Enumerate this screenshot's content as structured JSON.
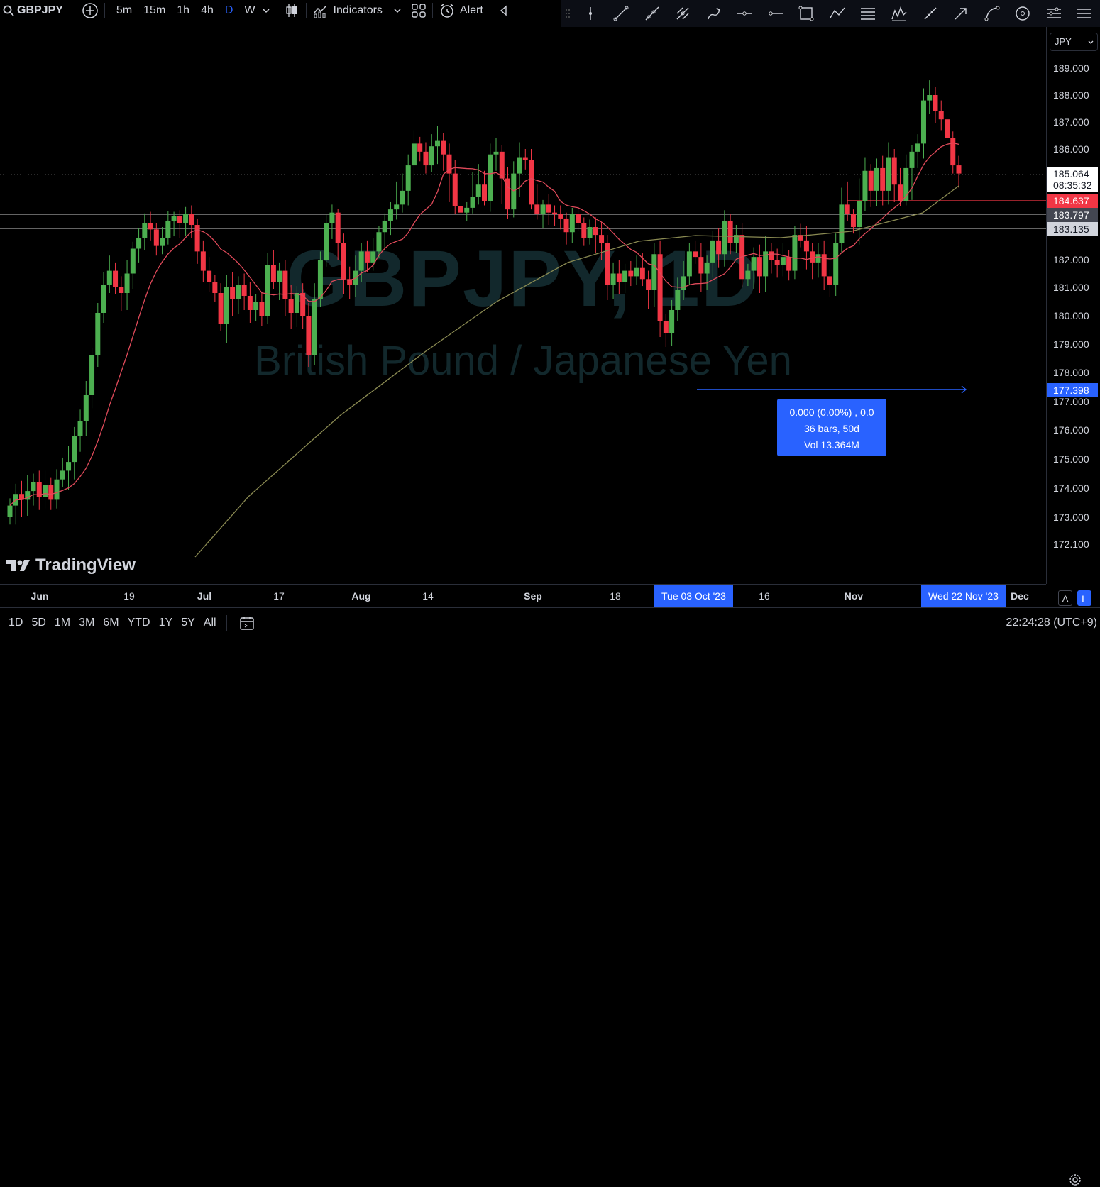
{
  "toolbar": {
    "symbol": "GBPJPY",
    "timeframes": [
      "5m",
      "15m",
      "1h",
      "4h",
      "D",
      "W"
    ],
    "active_timeframe": "D",
    "indicators_label": "Indicators",
    "alert_label": "Alert",
    "icons": [
      "search-icon",
      "add-symbol-icon",
      "chevron-down-icon",
      "candles-icon",
      "indicators-icon",
      "layout-grid-icon",
      "alert-clock-icon",
      "collapse-left-icon"
    ]
  },
  "drawing_tools": [
    "cursor-line-icon",
    "trend-line-icon",
    "ray-icon",
    "pitchfork-icon",
    "brush-icon",
    "horizontal-ray-icon",
    "horizontal-line-icon",
    "rectangle-icon",
    "path-icon",
    "fib-levels-icon",
    "pattern-icon",
    "measure-icon",
    "arrow-icon",
    "arc-icon",
    "circle-icon",
    "list-settings-icon",
    "more-icon"
  ],
  "watermark": {
    "symbol": "GBPJPY, 1D",
    "name": "British Pound / Japanese Yen"
  },
  "price_scale": {
    "currency": "JPY",
    "ticks": [
      "189.000",
      "188.000",
      "187.000",
      "186.000",
      "182.000",
      "181.000",
      "180.000",
      "179.000",
      "178.000",
      "177.000",
      "176.000",
      "175.000",
      "174.000",
      "173.000",
      "172.100"
    ],
    "current_price": "185.064",
    "countdown": "08:35:32",
    "tags": [
      {
        "value": "184.637",
        "bg": "#f23645",
        "color": "#ffffff"
      },
      {
        "value": "183.797",
        "bg": "#434651",
        "color": "#ffffff"
      },
      {
        "value": "183.135",
        "bg": "#d1d4dc",
        "color": "#131722"
      },
      {
        "value": "177.398",
        "bg": "#2962ff",
        "color": "#ffffff"
      }
    ]
  },
  "time_scale": {
    "labels": [
      {
        "text": "Jun",
        "bold": true
      },
      {
        "text": "19",
        "bold": false
      },
      {
        "text": "Jul",
        "bold": true
      },
      {
        "text": "17",
        "bold": false
      },
      {
        "text": "Aug",
        "bold": true
      },
      {
        "text": "14",
        "bold": false
      },
      {
        "text": "Sep",
        "bold": true
      },
      {
        "text": "18",
        "bold": false
      },
      {
        "text": "16",
        "bold": false
      },
      {
        "text": "Nov",
        "bold": true
      },
      {
        "text": "Dec",
        "bold": true
      }
    ],
    "highlight_start": "Tue 03 Oct '23",
    "highlight_end": "Wed 22 Nov '23"
  },
  "measure_box": {
    "line1": "0.000 (0.00%) , 0.0",
    "line2": "36 bars, 50d",
    "line3": "Vol 13.364M"
  },
  "logo": "TradingView",
  "scale_buttons": {
    "auto": "A",
    "log": "L"
  },
  "bottom_bar": {
    "ranges": [
      "1D",
      "5D",
      "1M",
      "3M",
      "6M",
      "YTD",
      "1Y",
      "5Y",
      "All"
    ],
    "clock": "22:24:28 (UTC+9)"
  },
  "colors": {
    "up": "#26a69a",
    "up_bright": "#4caf50",
    "down": "#f23645",
    "ma_fast": "#e04a5a",
    "ma_slow": "#8a8a52",
    "accent": "#2962ff"
  }
}
